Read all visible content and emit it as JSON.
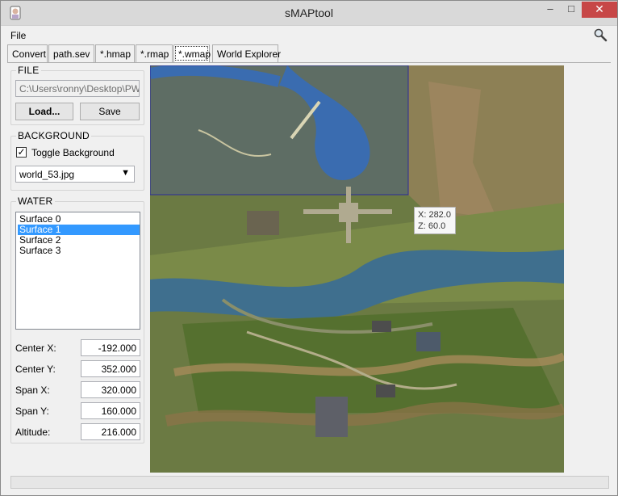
{
  "window": {
    "title": "sMAPtool"
  },
  "menu": {
    "file": "File"
  },
  "tabs": [
    "Convert",
    "path.sev",
    "*.hmap",
    "*.rmap",
    "*.wmap",
    "World Explorer"
  ],
  "file_group": {
    "title": "FILE",
    "path_value": "C:\\Users\\ronny\\Desktop\\PWS",
    "load_label": "Load...",
    "save_label": "Save"
  },
  "background_group": {
    "title": "BACKGROUND",
    "toggle_label": "Toggle Background",
    "toggle_checked": true,
    "selected_image": "world_53.jpg"
  },
  "water_group": {
    "title": "WATER",
    "surfaces": [
      "Surface 0",
      "Surface 1",
      "Surface 2",
      "Surface 3"
    ],
    "selected_index": 1,
    "fields": [
      {
        "label": "Center X:",
        "value": "-192.000"
      },
      {
        "label": "Center Y:",
        "value": "352.000"
      },
      {
        "label": "Span X:",
        "value": "320.000"
      },
      {
        "label": "Span Y:",
        "value": "160.000"
      },
      {
        "label": "Altitude:",
        "value": "216.000"
      }
    ]
  },
  "tooltip": {
    "x": "X: 282.0",
    "z": "Z: 60.0"
  },
  "colors": {
    "selection": "#3399ff",
    "close_button": "#c74747",
    "water": "#3f6f8e",
    "water_overlay": "#2a4a8a"
  }
}
